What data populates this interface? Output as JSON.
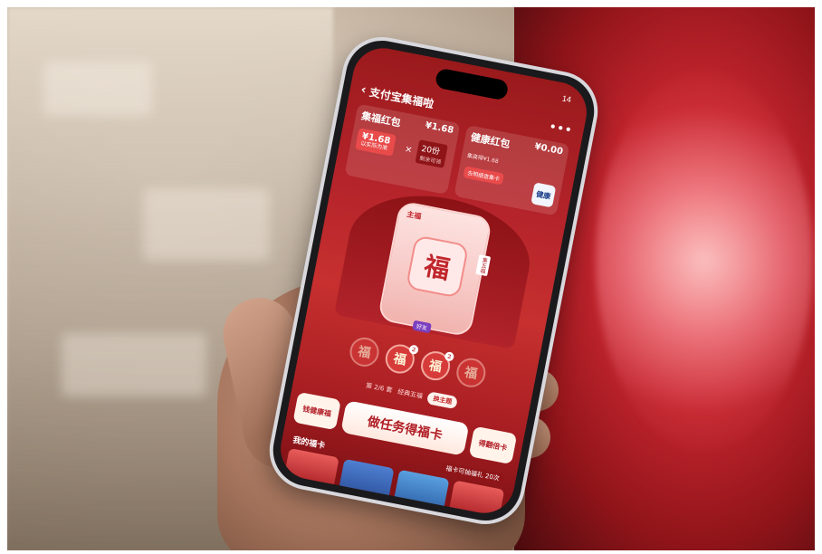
{
  "app": {
    "back_icon": "chevron-left-icon",
    "title": "支付宝集福啦",
    "more_label": "•••",
    "status_time": "14"
  },
  "cards": {
    "jifu": {
      "title": "集福红包",
      "amount": "¥1.68",
      "mini_value": "¥1.68",
      "mini_sub": "以实际为准",
      "times_sign": "×",
      "count": "20份",
      "count_sub": "剩余可领"
    },
    "health": {
      "title": "健康红包",
      "amount": "¥0.00",
      "sub": "集高得¥1.68",
      "button": "去明细查集卡",
      "icon_label": "健康"
    }
  },
  "fu_card": {
    "tag": "主福",
    "glyph": "福",
    "ribbon": "集五福",
    "badge": "好友"
  },
  "fu_chips": [
    {
      "glyph": "福",
      "count": "",
      "dim": true
    },
    {
      "glyph": "福",
      "count": "2",
      "dim": false
    },
    {
      "glyph": "福",
      "count": "2",
      "dim": false
    },
    {
      "glyph": "福",
      "count": "",
      "dim": true
    }
  ],
  "info": {
    "progress": "第 2/6 套",
    "set_name": "经典五福",
    "theme_button": "换主题"
  },
  "actions": {
    "left": "钱健康福",
    "main": "做任务得福卡",
    "right": "得翻倍卡"
  },
  "my_cards": {
    "label": "我的福卡",
    "right": "福卡可抽福礼 20次"
  },
  "colors": {
    "accent": "#c7302f",
    "button_text": "#b01d24"
  }
}
